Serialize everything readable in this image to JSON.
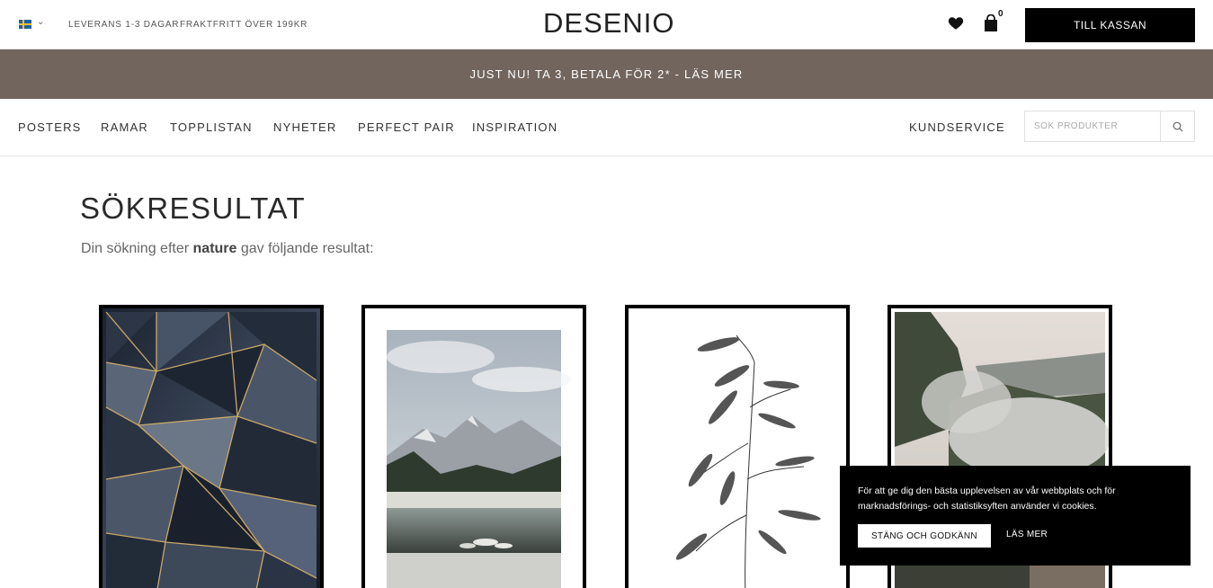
{
  "topbar": {
    "flag": "sweden-flag-icon",
    "info1": "LEVERANS 1-3 DAGAR",
    "info2": "FRAKTFRITT ÖVER 199KR",
    "logo": "DESENIO",
    "cart_count": "0",
    "checkout_label": "TILL KASSAN"
  },
  "promo": {
    "text": "JUST NU! TA 3, BETALA FÖR 2* - LÄS MER"
  },
  "nav": {
    "items": [
      "POSTERS",
      "RAMAR",
      "TOPPLISTAN",
      "NYHETER",
      "PERFECT PAIR",
      "INSPIRATION"
    ],
    "customer_service": "KUNDSERVICE",
    "search_placeholder": "SÖK PRODUKTER"
  },
  "main": {
    "title": "SÖKRESULTAT",
    "subtitle_before": "Din sökning efter ",
    "query": "nature",
    "subtitle_after": " gav följande resultat:"
  },
  "products": [
    {
      "name": "geometric-dark-blue-poster"
    },
    {
      "name": "mountain-lake-poster"
    },
    {
      "name": "oat-grass-poster"
    },
    {
      "name": "misty-forest-poster"
    }
  ],
  "cookie": {
    "text": "För att ge dig den bästa upplevelsen av vår webbplats och för marknadsförings- och statistiksyften använder vi cookies.",
    "accept_label": "STÄNG OCH GODKÄNN",
    "more_label": "LÄS MER"
  },
  "colors": {
    "promo_bg": "#71655d",
    "checkout_bg": "#000000",
    "cookie_bg": "#000000"
  }
}
